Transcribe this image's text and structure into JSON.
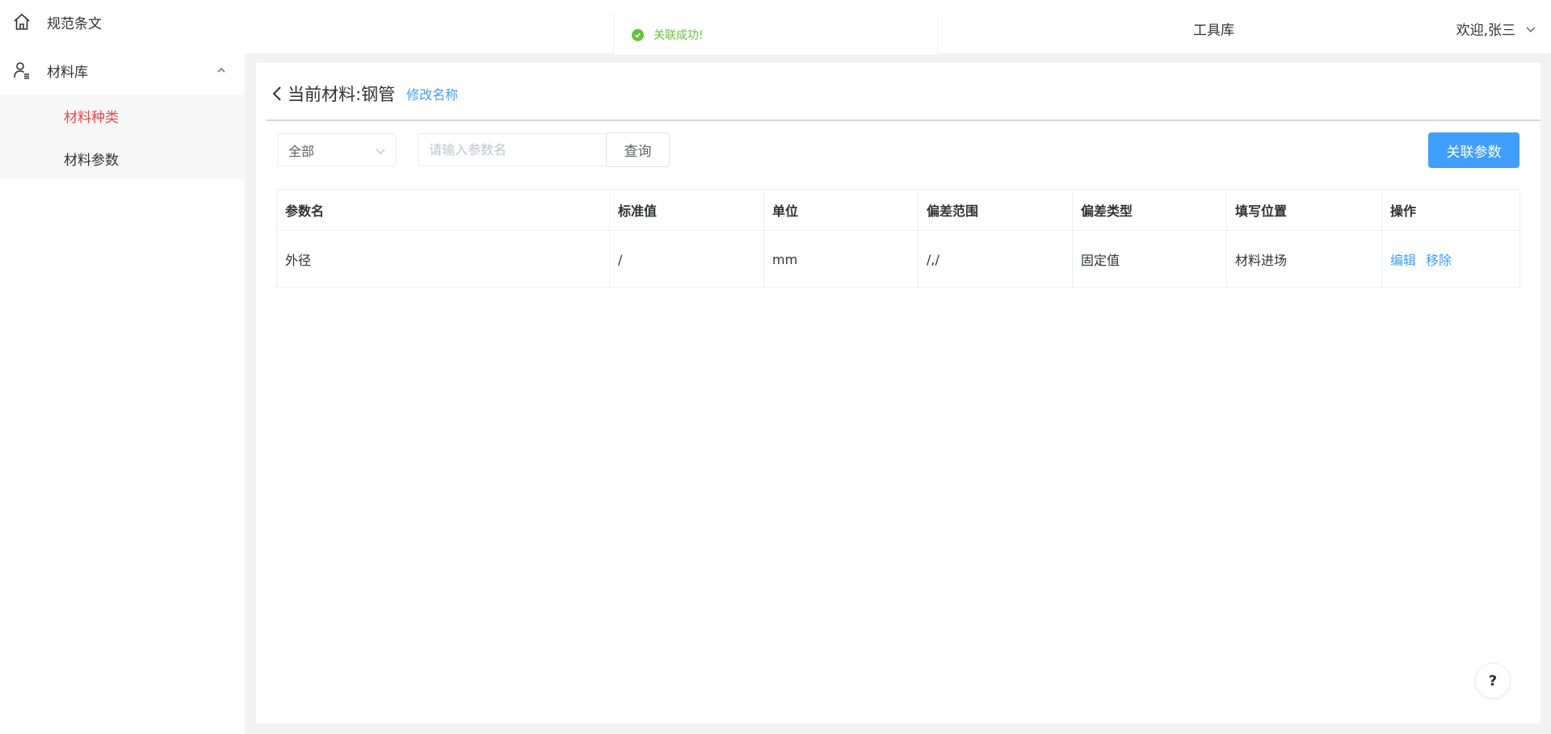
{
  "sidebar": {
    "home_label": "规范条文",
    "library_label": "材料库",
    "sub_items": [
      "材料种类",
      "材料参数"
    ],
    "active_sub_index": 0
  },
  "header": {
    "toolbox_label": "工具库",
    "welcome_text": "欢迎,张三"
  },
  "toast": {
    "message": "关联成功!",
    "type": "success"
  },
  "page": {
    "title": "当前材料:钢管",
    "rename_label": "修改名称"
  },
  "filters": {
    "select_value": "全部",
    "search_placeholder": "请输入参数名",
    "search_value": "",
    "query_label": "查询",
    "link_params_label": "关联参数"
  },
  "table": {
    "columns": [
      "参数名",
      "标准值",
      "单位",
      "偏差范围",
      "偏差类型",
      "填写位置",
      "操作"
    ],
    "rows": [
      {
        "name": "外径",
        "standard": "/",
        "unit": "mm",
        "range": "/,/",
        "deviation_type": "固定值",
        "position": "材料进场",
        "actions": [
          "编辑",
          "移除"
        ]
      }
    ]
  },
  "help_label": "?",
  "colors": {
    "primary": "#409eff",
    "active_menu": "#e8474a",
    "success": "#67c23a"
  }
}
